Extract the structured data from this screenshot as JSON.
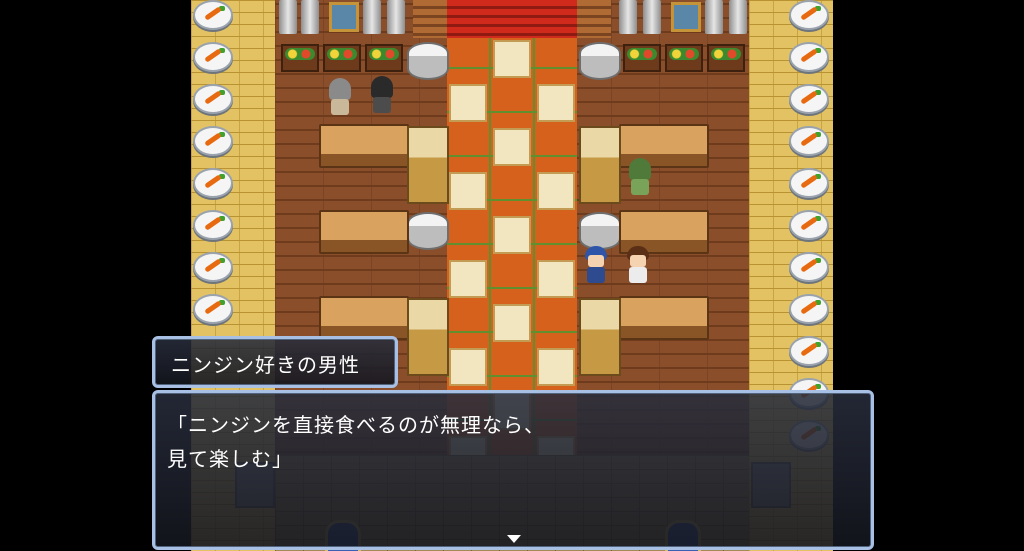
{
  "dialogue": {
    "speaker_name": "ニンジン好きの男性",
    "line1": "「ニンジンを直接食べるのが無理なら、",
    "line2": "見て楽しむ」",
    "continue_indicator": "pause-arrow"
  },
  "map": {
    "scene": "carrot-themed hall with red carpet",
    "colors": {
      "carpet": "#d6611d",
      "wall": "#e2c263",
      "floor": "#8a4e2a",
      "window_frame": "#a8c0e4"
    }
  },
  "characters": [
    {
      "name": "npc-gray-hair",
      "facing": "up"
    },
    {
      "name": "npc-dark-hair",
      "facing": "up"
    },
    {
      "name": "npc-green-hooded",
      "facing": "up"
    },
    {
      "name": "player-blue-hair",
      "facing": "right"
    },
    {
      "name": "npc-carrot-lover-man",
      "facing": "left"
    }
  ]
}
